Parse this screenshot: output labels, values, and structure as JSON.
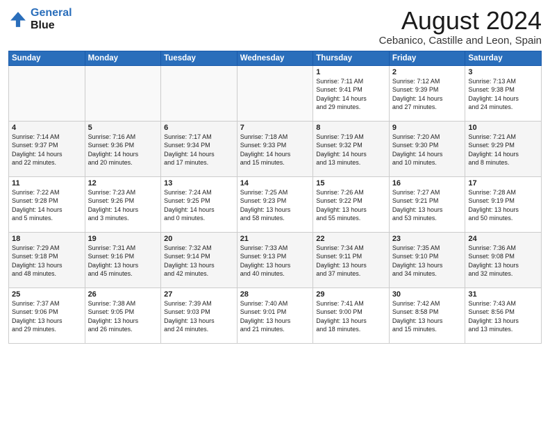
{
  "header": {
    "logo_line1": "General",
    "logo_line2": "Blue",
    "month": "August 2024",
    "location": "Cebanico, Castille and Leon, Spain"
  },
  "weekdays": [
    "Sunday",
    "Monday",
    "Tuesday",
    "Wednesday",
    "Thursday",
    "Friday",
    "Saturday"
  ],
  "weeks": [
    [
      {
        "day": "",
        "info": ""
      },
      {
        "day": "",
        "info": ""
      },
      {
        "day": "",
        "info": ""
      },
      {
        "day": "",
        "info": ""
      },
      {
        "day": "1",
        "info": "Sunrise: 7:11 AM\nSunset: 9:41 PM\nDaylight: 14 hours\nand 29 minutes."
      },
      {
        "day": "2",
        "info": "Sunrise: 7:12 AM\nSunset: 9:39 PM\nDaylight: 14 hours\nand 27 minutes."
      },
      {
        "day": "3",
        "info": "Sunrise: 7:13 AM\nSunset: 9:38 PM\nDaylight: 14 hours\nand 24 minutes."
      }
    ],
    [
      {
        "day": "4",
        "info": "Sunrise: 7:14 AM\nSunset: 9:37 PM\nDaylight: 14 hours\nand 22 minutes."
      },
      {
        "day": "5",
        "info": "Sunrise: 7:16 AM\nSunset: 9:36 PM\nDaylight: 14 hours\nand 20 minutes."
      },
      {
        "day": "6",
        "info": "Sunrise: 7:17 AM\nSunset: 9:34 PM\nDaylight: 14 hours\nand 17 minutes."
      },
      {
        "day": "7",
        "info": "Sunrise: 7:18 AM\nSunset: 9:33 PM\nDaylight: 14 hours\nand 15 minutes."
      },
      {
        "day": "8",
        "info": "Sunrise: 7:19 AM\nSunset: 9:32 PM\nDaylight: 14 hours\nand 13 minutes."
      },
      {
        "day": "9",
        "info": "Sunrise: 7:20 AM\nSunset: 9:30 PM\nDaylight: 14 hours\nand 10 minutes."
      },
      {
        "day": "10",
        "info": "Sunrise: 7:21 AM\nSunset: 9:29 PM\nDaylight: 14 hours\nand 8 minutes."
      }
    ],
    [
      {
        "day": "11",
        "info": "Sunrise: 7:22 AM\nSunset: 9:28 PM\nDaylight: 14 hours\nand 5 minutes."
      },
      {
        "day": "12",
        "info": "Sunrise: 7:23 AM\nSunset: 9:26 PM\nDaylight: 14 hours\nand 3 minutes."
      },
      {
        "day": "13",
        "info": "Sunrise: 7:24 AM\nSunset: 9:25 PM\nDaylight: 14 hours\nand 0 minutes."
      },
      {
        "day": "14",
        "info": "Sunrise: 7:25 AM\nSunset: 9:23 PM\nDaylight: 13 hours\nand 58 minutes."
      },
      {
        "day": "15",
        "info": "Sunrise: 7:26 AM\nSunset: 9:22 PM\nDaylight: 13 hours\nand 55 minutes."
      },
      {
        "day": "16",
        "info": "Sunrise: 7:27 AM\nSunset: 9:21 PM\nDaylight: 13 hours\nand 53 minutes."
      },
      {
        "day": "17",
        "info": "Sunrise: 7:28 AM\nSunset: 9:19 PM\nDaylight: 13 hours\nand 50 minutes."
      }
    ],
    [
      {
        "day": "18",
        "info": "Sunrise: 7:29 AM\nSunset: 9:18 PM\nDaylight: 13 hours\nand 48 minutes."
      },
      {
        "day": "19",
        "info": "Sunrise: 7:31 AM\nSunset: 9:16 PM\nDaylight: 13 hours\nand 45 minutes."
      },
      {
        "day": "20",
        "info": "Sunrise: 7:32 AM\nSunset: 9:14 PM\nDaylight: 13 hours\nand 42 minutes."
      },
      {
        "day": "21",
        "info": "Sunrise: 7:33 AM\nSunset: 9:13 PM\nDaylight: 13 hours\nand 40 minutes."
      },
      {
        "day": "22",
        "info": "Sunrise: 7:34 AM\nSunset: 9:11 PM\nDaylight: 13 hours\nand 37 minutes."
      },
      {
        "day": "23",
        "info": "Sunrise: 7:35 AM\nSunset: 9:10 PM\nDaylight: 13 hours\nand 34 minutes."
      },
      {
        "day": "24",
        "info": "Sunrise: 7:36 AM\nSunset: 9:08 PM\nDaylight: 13 hours\nand 32 minutes."
      }
    ],
    [
      {
        "day": "25",
        "info": "Sunrise: 7:37 AM\nSunset: 9:06 PM\nDaylight: 13 hours\nand 29 minutes."
      },
      {
        "day": "26",
        "info": "Sunrise: 7:38 AM\nSunset: 9:05 PM\nDaylight: 13 hours\nand 26 minutes."
      },
      {
        "day": "27",
        "info": "Sunrise: 7:39 AM\nSunset: 9:03 PM\nDaylight: 13 hours\nand 24 minutes."
      },
      {
        "day": "28",
        "info": "Sunrise: 7:40 AM\nSunset: 9:01 PM\nDaylight: 13 hours\nand 21 minutes."
      },
      {
        "day": "29",
        "info": "Sunrise: 7:41 AM\nSunset: 9:00 PM\nDaylight: 13 hours\nand 18 minutes."
      },
      {
        "day": "30",
        "info": "Sunrise: 7:42 AM\nSunset: 8:58 PM\nDaylight: 13 hours\nand 15 minutes."
      },
      {
        "day": "31",
        "info": "Sunrise: 7:43 AM\nSunset: 8:56 PM\nDaylight: 13 hours\nand 13 minutes."
      }
    ]
  ]
}
